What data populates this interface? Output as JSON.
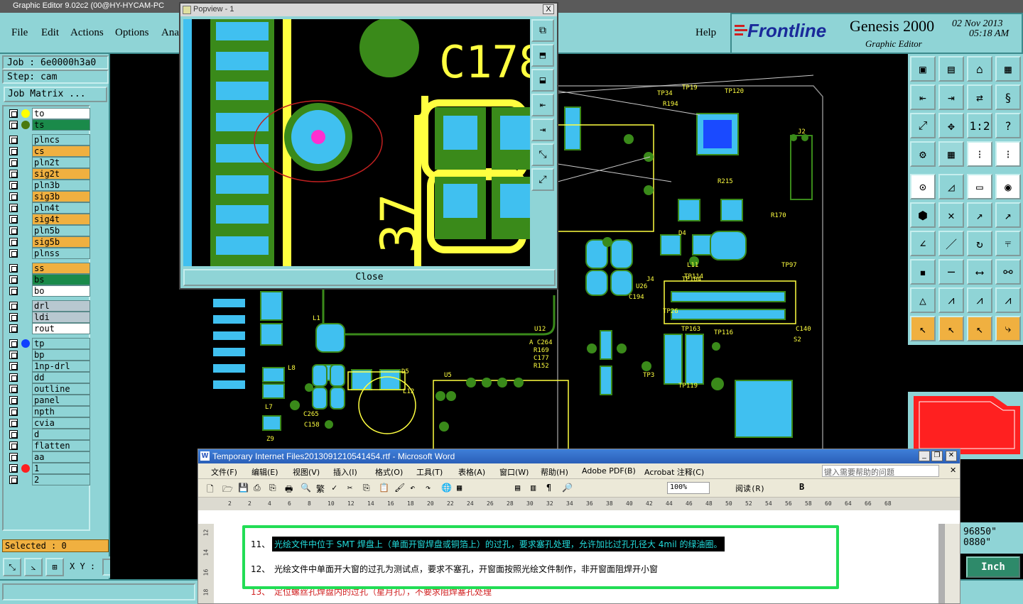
{
  "app_title": "Graphic Editor 9.02c2 (00@HY-HYCAM-PC",
  "menu": [
    "File",
    "Edit",
    "Actions",
    "Options",
    "Ana"
  ],
  "help_label": "Help",
  "brand": {
    "logo": "Frontline",
    "product": "Genesis 2000",
    "subtitle": "Graphic Editor",
    "date": "02 Nov 2013",
    "time": "05:18 AM"
  },
  "job": {
    "job_label": "Job : 6e0000h3a0",
    "step_label": "Step: cam",
    "matrix_button": "Job Matrix ..."
  },
  "layers": [
    {
      "name": "to",
      "color": "#ffffff",
      "dot": "#ffff00"
    },
    {
      "name": "ts",
      "color": "#1a8a4a",
      "dot": "#4a7a10"
    },
    {
      "name": "plncs",
      "color": "#8fd4d6"
    },
    {
      "name": "cs",
      "color": "#f0b040"
    },
    {
      "name": "pln2t",
      "color": "#8fd4d6"
    },
    {
      "name": "sig2t",
      "color": "#f0b040"
    },
    {
      "name": "pln3b",
      "color": "#8fd4d6"
    },
    {
      "name": "sig3b",
      "color": "#f0b040"
    },
    {
      "name": "pln4t",
      "color": "#8fd4d6"
    },
    {
      "name": "sig4t",
      "color": "#f0b040"
    },
    {
      "name": "pln5b",
      "color": "#8fd4d6"
    },
    {
      "name": "sig5b",
      "color": "#f0b040"
    },
    {
      "name": "plnss",
      "color": "#8fd4d6"
    },
    {
      "name": "ss",
      "color": "#f0b040"
    },
    {
      "name": "bs",
      "color": "#1a8a4a"
    },
    {
      "name": "bo",
      "color": "#ffffff"
    },
    {
      "name": "drl",
      "color": "#b8c8d0"
    },
    {
      "name": "ldi",
      "color": "#b8c8d0"
    },
    {
      "name": "rout",
      "color": "#ffffff"
    },
    {
      "name": "tp",
      "color": "#8fd4d6",
      "dot": "#1040ff"
    },
    {
      "name": "bp",
      "color": "#8fd4d6"
    },
    {
      "name": "1np-drl",
      "color": "#8fd4d6"
    },
    {
      "name": "dd",
      "color": "#8fd4d6"
    },
    {
      "name": "outline",
      "color": "#8fd4d6"
    },
    {
      "name": "panel",
      "color": "#8fd4d6"
    },
    {
      "name": "npth",
      "color": "#8fd4d6"
    },
    {
      "name": "cvia",
      "color": "#8fd4d6"
    },
    {
      "name": "d",
      "color": "#8fd4d6"
    },
    {
      "name": "flatten",
      "color": "#8fd4d6"
    },
    {
      "name": "aa",
      "color": "#8fd4d6"
    },
    {
      "name": "1",
      "color": "#8fd4d6",
      "dot": "#ff2020"
    },
    {
      "name": "2",
      "color": "#8fd4d6"
    }
  ],
  "selected": "Selected : 0",
  "xy_label": "X Y :",
  "coord_1": "96850\"",
  "coord_2": "0880\"",
  "unit_button": "Inch",
  "popview": {
    "title": "Popview - 1",
    "close_label": "Close",
    "label_c178": "C178",
    "close_x": "X"
  },
  "word": {
    "title": "Temporary Internet Files2013091210541454.rtf - Microsoft Word",
    "menu": [
      "文件(F)",
      "编辑(E)",
      "视图(V)",
      "插入(I)",
      "格式(O)",
      "工具(T)",
      "表格(A)",
      "窗口(W)",
      "帮助(H)",
      "Adobe PDF(B)",
      "Acrobat 注释(C)"
    ],
    "help_placeholder": "键入需要帮助的问题",
    "zoom": "100%",
    "read_label": "阅读(R)",
    "bold": "B",
    "ruler_ticks": [
      "2",
      "2",
      "4",
      "6",
      "8",
      "10",
      "12",
      "14",
      "16",
      "18",
      "20",
      "22",
      "24",
      "26",
      "28",
      "30",
      "32",
      "34",
      "36",
      "38",
      "40",
      "42",
      "44",
      "46",
      "48",
      "50",
      "52",
      "54",
      "56",
      "58",
      "60",
      "64",
      "66",
      "68"
    ],
    "line11_num": "11、",
    "line11": "光绘文件中位于 SMT 焊盘上（单面开窗焊盘或铜箔上）的过孔，要求塞孔处理，允许加比过孔孔径大 4mil 的绿油圈。",
    "line12_num": "12、",
    "line12": "光绘文件中单面开大窗的过孔为测试点，要求不塞孔，开窗面按照光绘文件制作，非开窗面阻焊开小窗",
    "line13_num": "13、",
    "line13": "定位螺丝孔焊盘内的过孔（星月孔），不要求阻焊塞孔处理"
  },
  "colors": {
    "panel": "#8fd4d6",
    "accent_orange": "#f0b040",
    "pcb_green": "#3a8a1a",
    "pcb_blue": "#40c0f0",
    "pcb_yellow": "#ffff40",
    "highlight": "#22dd55"
  }
}
